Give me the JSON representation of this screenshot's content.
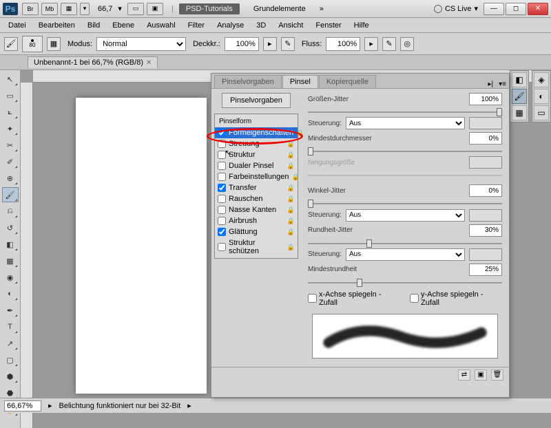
{
  "titlebar": {
    "ps": "Ps",
    "br": "Br",
    "mb": "Mb",
    "zoom": "66,7",
    "doc1": "PSD-Tutorials",
    "doc2": "Grundelemente",
    "cslive": "CS Live",
    "chev": "»"
  },
  "menu": [
    "Datei",
    "Bearbeiten",
    "Bild",
    "Ebene",
    "Auswahl",
    "Filter",
    "Analyse",
    "3D",
    "Ansicht",
    "Fenster",
    "Hilfe"
  ],
  "options": {
    "brush_size": "80",
    "modus_label": "Modus:",
    "modus_value": "Normal",
    "deck_label": "Deckkr.:",
    "deck_value": "100%",
    "fluss_label": "Fluss:",
    "fluss_value": "100%"
  },
  "doctab": {
    "title": "Unbenannt-1 bei 66,7% (RGB/8)"
  },
  "status": {
    "zoom": "66,67%",
    "msg": "Belichtung funktioniert nur bei 32-Bit"
  },
  "panel": {
    "tabs": [
      "Pinselvorgaben",
      "Pinsel",
      "Kopierquelle"
    ],
    "active_tab": 1,
    "btn": "Pinselvorgaben",
    "header": "Pinselform",
    "items": [
      {
        "label": "Formeigenschaften",
        "checked": true,
        "selected": true,
        "lock": true
      },
      {
        "label": "Streuung",
        "checked": false,
        "lock": true,
        "cursor": true
      },
      {
        "label": "Struktur",
        "checked": false,
        "lock": true
      },
      {
        "label": "Dualer Pinsel",
        "checked": false,
        "lock": true
      },
      {
        "label": "Farbeinstellungen",
        "checked": false,
        "lock": true
      },
      {
        "label": "Transfer",
        "checked": true,
        "lock": true
      },
      {
        "label": "Rauschen",
        "checked": false,
        "lock": true
      },
      {
        "label": "Nasse Kanten",
        "checked": false,
        "lock": true
      },
      {
        "label": "Airbrush",
        "checked": false,
        "lock": true
      },
      {
        "label": "Glättung",
        "checked": true,
        "lock": true
      },
      {
        "label": "Struktur schützen",
        "checked": false,
        "lock": true
      }
    ],
    "props": {
      "groessen_jitter": {
        "label": "Größen-Jitter",
        "value": "100%",
        "thumb": 100
      },
      "steuerung": "Steuerung:",
      "aus": "Aus",
      "mindest": {
        "label": "Mindestdurchmesser",
        "value": "0%",
        "thumb": 0
      },
      "neigung": {
        "label": "Neigungsgröße",
        "disabled": true
      },
      "winkel": {
        "label": "Winkel-Jitter",
        "value": "0%",
        "thumb": 0
      },
      "rundheit": {
        "label": "Rundheit-Jitter",
        "value": "30%",
        "thumb": 30
      },
      "mindestrund": {
        "label": "Mindestrundheit",
        "value": "25%",
        "thumb": 25
      },
      "mirror_x": "x-Achse spiegeln - Zufall",
      "mirror_y": "y-Achse spiegeln - Zufall"
    }
  }
}
